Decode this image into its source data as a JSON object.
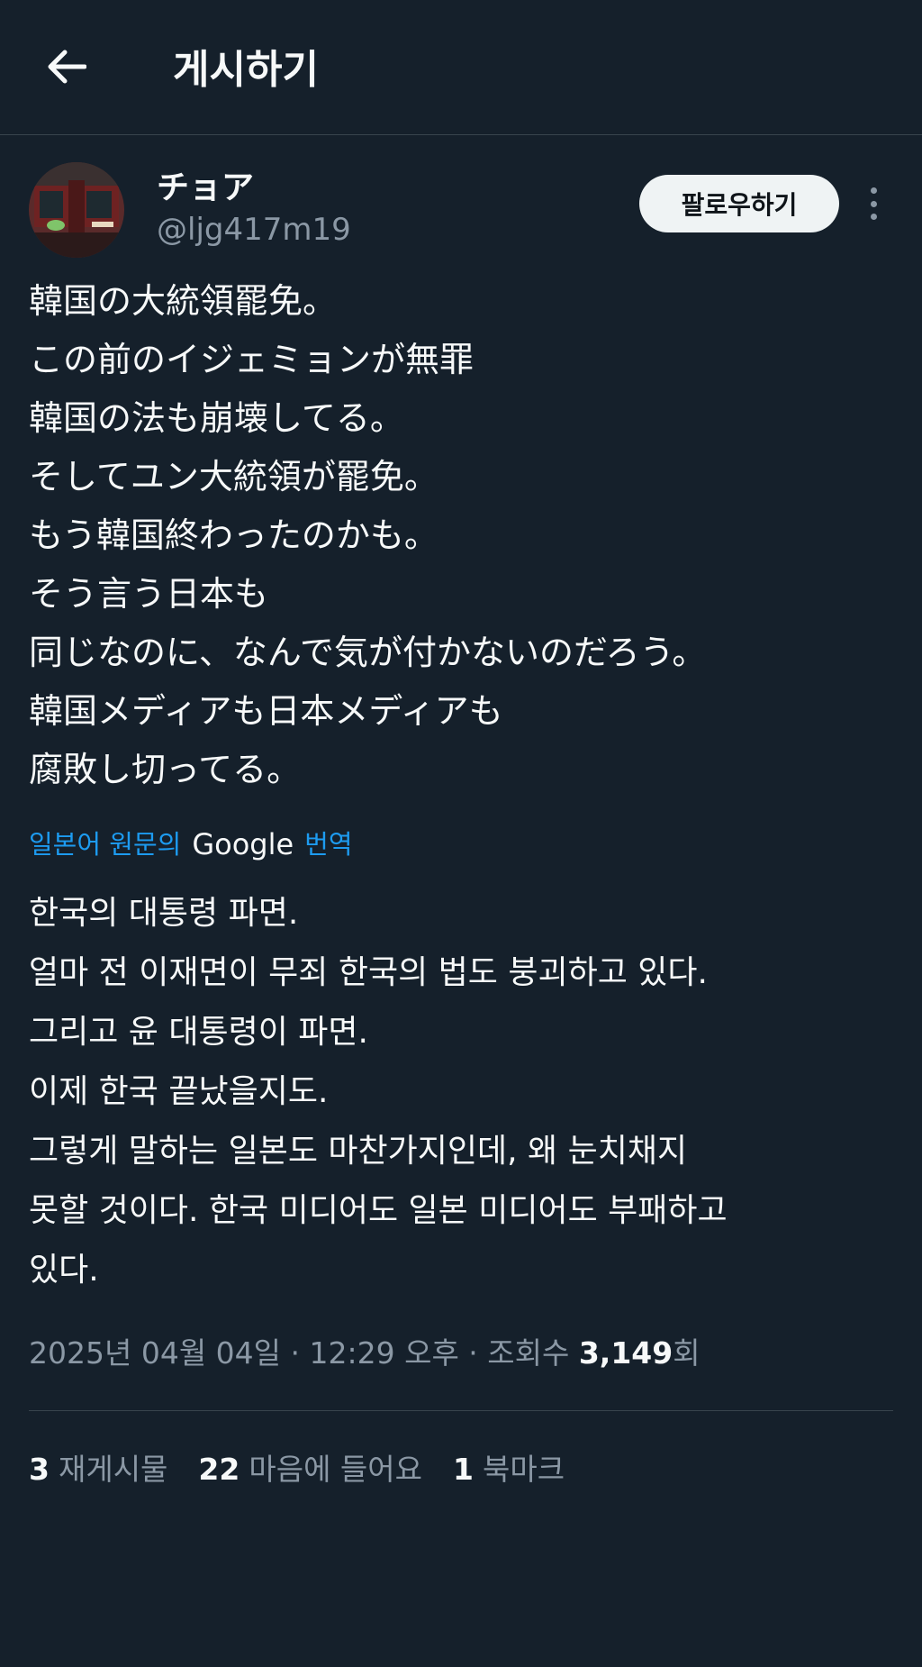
{
  "header": {
    "title": "게시하기",
    "back_icon": "arrow-left-icon"
  },
  "author": {
    "display_name": "チョア",
    "handle": "@ljg417m19",
    "avatar": "train-photo-avatar"
  },
  "actions": {
    "follow_label": "팔로우하기",
    "more_icon": "more-vertical-icon"
  },
  "post": {
    "lines": [
      "韓国の大統領罷免。",
      "この前のイジェミョンが無罪",
      "韓国の法も崩壊してる。",
      "そしてユン大統領が罷免。",
      "もう韓国終わったのかも。",
      "そう言う日本も",
      "同じなのに、なんで気が付かないのだろう。",
      "韓国メディアも日本メディアも",
      "腐敗し切ってる。"
    ]
  },
  "translation": {
    "prefix": "일본어 원문의",
    "provider": "Google",
    "suffix": "번역",
    "lines": [
      "한국의 대통령 파면.",
      "얼마 전 이재면이 무죄 한국의 법도 붕괴하고 있다.",
      "그리고 윤 대통령이 파면.",
      "이제 한국 끝났을지도.",
      "그렇게 말하는 일본도 마찬가지인데, 왜 눈치채지",
      "못할 것이다. 한국 미디어도 일본 미디어도 부패하고",
      "있다."
    ]
  },
  "meta": {
    "timestamp": "2025년 04월 04일 · 12:29 오후 · 조회수 ",
    "views": "3,149",
    "views_suffix": "회"
  },
  "stats": {
    "reposts_count": "3",
    "reposts_label": "재게시물",
    "likes_count": "22",
    "likes_label": "마음에 들어요",
    "bookmarks_count": "1",
    "bookmarks_label": "북마크"
  },
  "colors": {
    "background": "#15202b",
    "text": "#f7f9f9",
    "muted": "#8b98a5",
    "link": "#1d9bf0",
    "divider": "#38444d"
  }
}
